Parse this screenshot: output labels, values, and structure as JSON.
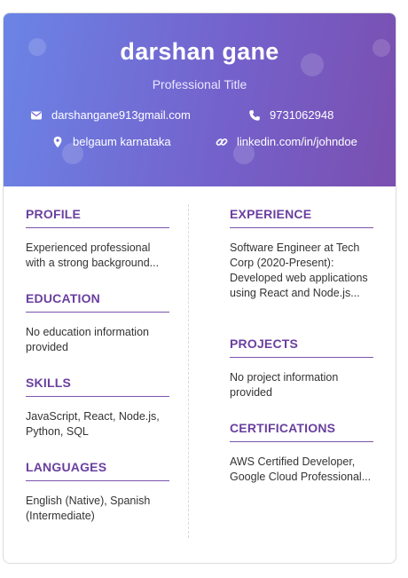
{
  "header": {
    "name": "darshan gane",
    "title": "Professional Title",
    "email": "darshangane913gmail.com",
    "phone": "9731062948",
    "location": "belgaum karnataka",
    "linkedin": "linkedin.com/in/johndoe"
  },
  "left": {
    "profile": {
      "heading": "PROFILE",
      "text": "Experienced professional with a strong background..."
    },
    "education": {
      "heading": "EDUCATION",
      "text": "No education information provided"
    },
    "skills": {
      "heading": "SKILLS",
      "text": "JavaScript, React, Node.js, Python, SQL"
    },
    "languages": {
      "heading": "LANGUAGES",
      "text": "English (Native), Spanish (Intermediate)"
    }
  },
  "right": {
    "experience": {
      "heading": "EXPERIENCE",
      "text": "Software Engineer at Tech Corp (2020-Present): Developed web applications using React and Node.js..."
    },
    "projects": {
      "heading": "PROJECTS",
      "text": "No project information provided"
    },
    "certifications": {
      "heading": "CERTIFICATIONS",
      "text": "AWS Certified Developer, Google Cloud Professional..."
    }
  },
  "colors": {
    "header_gradient_start": "#6b84e6",
    "header_gradient_end": "#7a4fb0",
    "section_heading": "#6a3f9f"
  },
  "icons": {
    "email": "envelope-icon",
    "phone": "phone-icon",
    "location": "map-pin-icon",
    "linkedin": "link-icon"
  }
}
